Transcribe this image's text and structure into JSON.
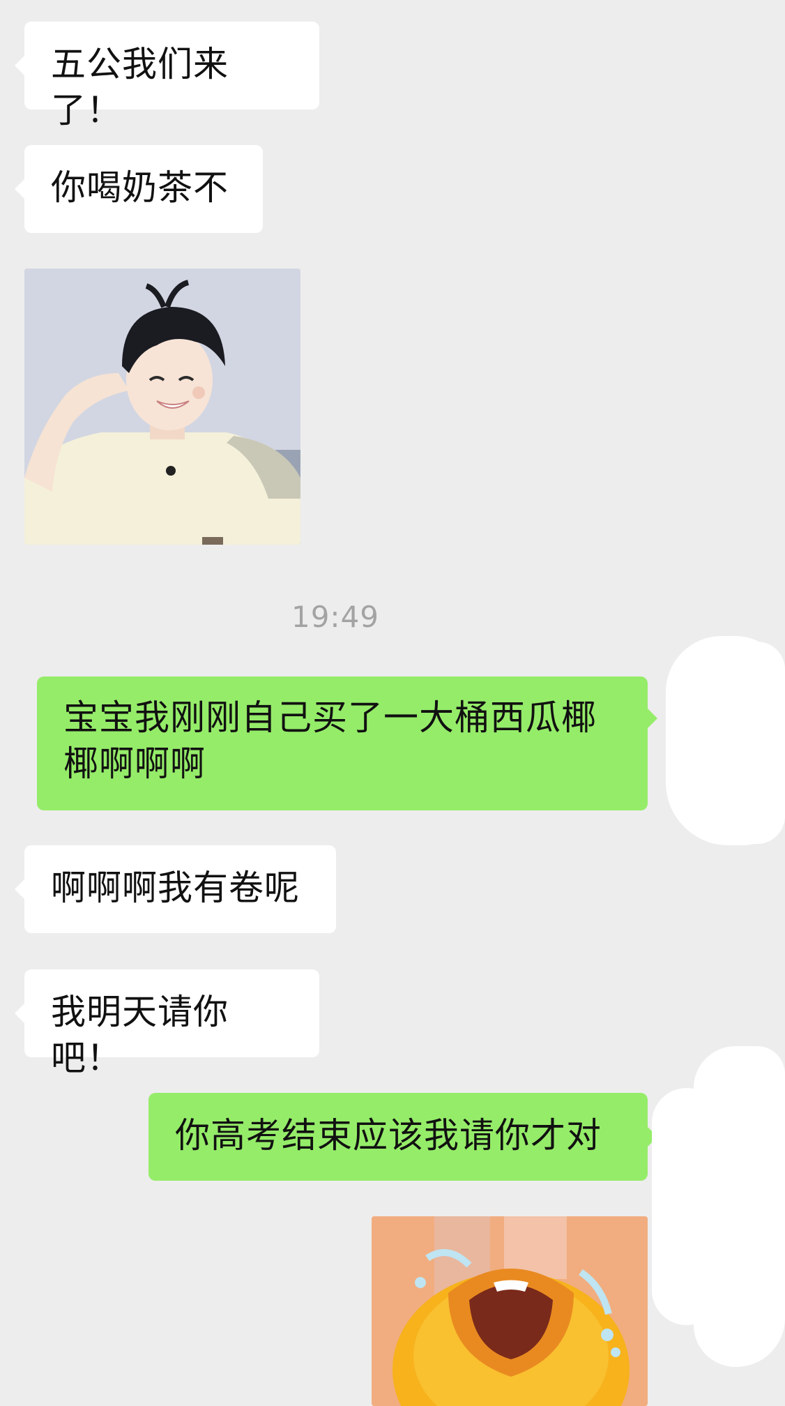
{
  "conversation": {
    "messages": [
      {
        "side": "incoming",
        "type": "text",
        "text": "五公我们来了！"
      },
      {
        "side": "incoming",
        "type": "text",
        "text": "你喝奶茶不"
      },
      {
        "side": "incoming",
        "type": "image",
        "image": "photo-boy-in-cream-tshirt"
      },
      {
        "type": "timestamp",
        "text": "19:49"
      },
      {
        "side": "outgoing",
        "type": "text",
        "lines": [
          "宝宝我刚刚自己买了一大桶西瓜椰",
          "椰啊啊啊"
        ]
      },
      {
        "side": "incoming",
        "type": "text",
        "text": "啊啊啊我有卷呢"
      },
      {
        "side": "incoming",
        "type": "text",
        "text": "我明天请你吧！"
      },
      {
        "side": "outgoing",
        "type": "text",
        "text": "你高考结束应该我请你才对"
      },
      {
        "side": "outgoing",
        "type": "image",
        "image": "sticker-crying-yellow-duck"
      }
    ]
  },
  "colors": {
    "background": "#ededed",
    "incoming_bubble": "#ffffff",
    "outgoing_bubble": "#95ec69",
    "timestamp": "#a3a3a3"
  }
}
